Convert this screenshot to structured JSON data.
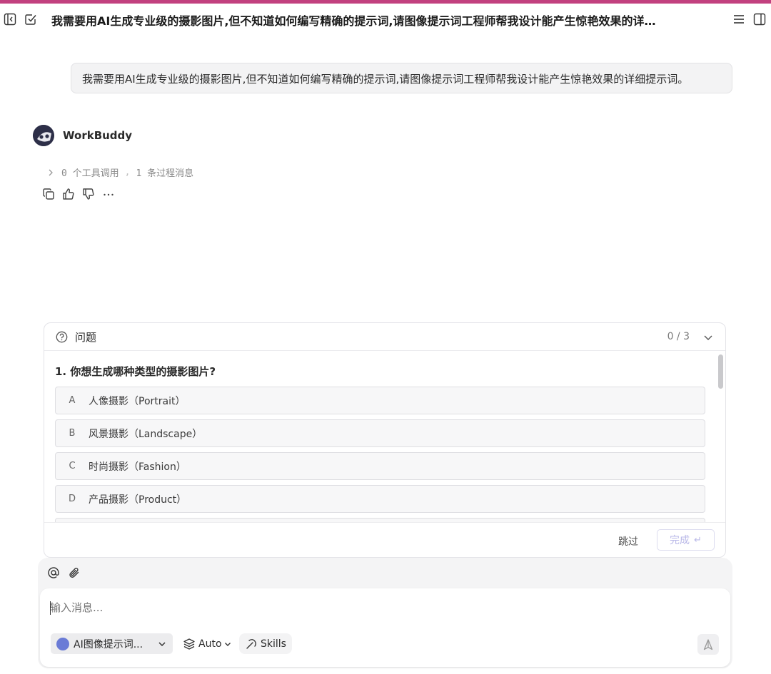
{
  "header": {
    "title": "我需要用AI生成专业级的摄影图片,但不知道如何编写精确的提示词,请图像提示词工程师帮我设计能产生惊艳效果的详细提示词。",
    "left_icons": [
      "collapse-sidebar-icon",
      "task-check-icon"
    ],
    "right_icons": [
      "menu-icon",
      "split-panel-icon"
    ]
  },
  "conversation": {
    "user_message": "我需要用AI生成专业级的摄影图片,但不知道如何编写精确的提示词,请图像提示词工程师帮我设计能产生惊艳效果的详细提示词。",
    "assistant": {
      "name": "WorkBuddy",
      "process_tools": "0 个工具调用",
      "process_separator": ",",
      "process_messages": "1 条过程消息"
    }
  },
  "question_panel": {
    "label": "问题",
    "progress": "0 / 3",
    "question": "1. 你想生成哪种类型的摄影图片?",
    "options": [
      {
        "letter": "A",
        "text": "人像摄影（Portrait）"
      },
      {
        "letter": "B",
        "text": "风景摄影（Landscape）"
      },
      {
        "letter": "C",
        "text": "时尚摄影（Fashion）"
      },
      {
        "letter": "D",
        "text": "产品摄影（Product）"
      }
    ],
    "skip_label": "跳过",
    "done_label": "完成",
    "done_icon": "↵"
  },
  "composer": {
    "placeholder": "输入消息...",
    "agent_label": "AI图像提示词...",
    "mode_label": "Auto",
    "skills_label": "Skills"
  },
  "colors": {
    "accent_bar": "#c2417f",
    "done_text": "#b9b8e8"
  }
}
